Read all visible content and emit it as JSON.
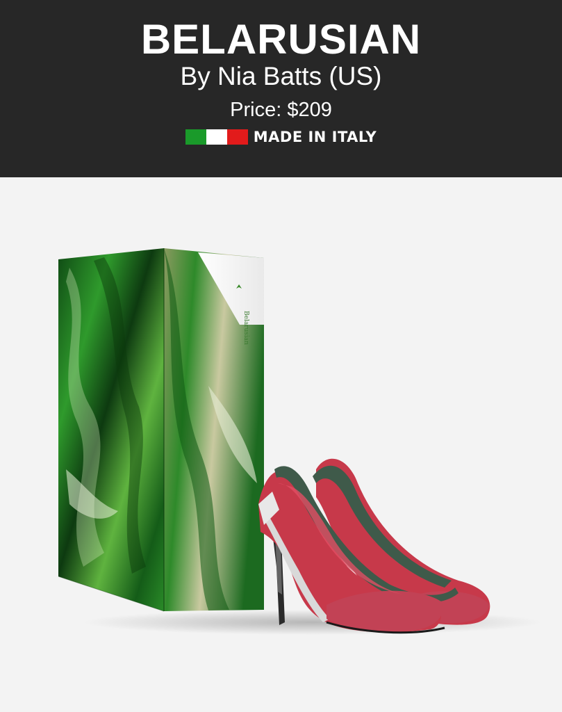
{
  "product": {
    "name": "BELARUSIAN",
    "designer": "By Nia Batts (US)",
    "price": "Price: $209",
    "origin": "MADE IN ITALY"
  },
  "flag_colors": [
    "#1a9a2a",
    "#ffffff",
    "#e21b1b"
  ],
  "box_label": {
    "brand": "Belarusian"
  },
  "colors": {
    "header_bg": "#272727",
    "page_bg": "#f3f3f3",
    "shoe_red": "#c83a4c",
    "shoe_green": "#3f5a4a",
    "box_green": "#1f7a24"
  }
}
